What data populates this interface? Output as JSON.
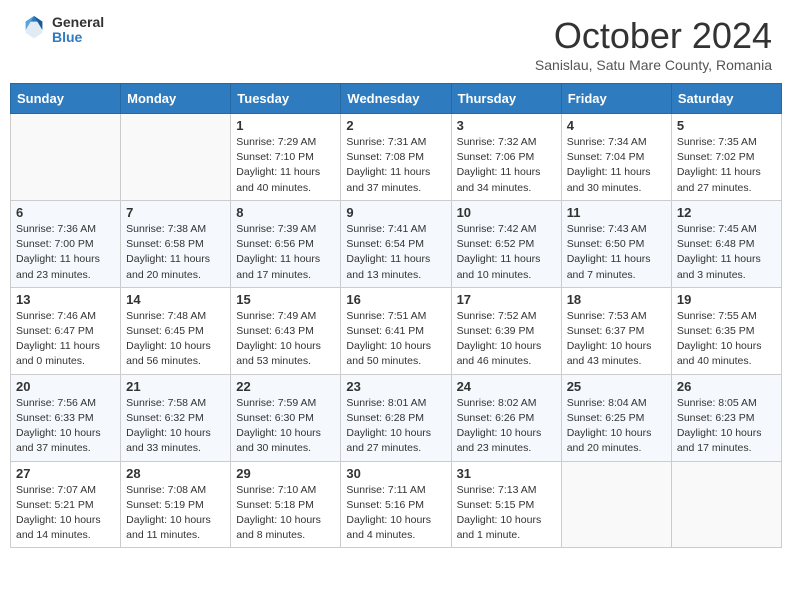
{
  "header": {
    "logo": {
      "general": "General",
      "blue": "Blue"
    },
    "title": "October 2024",
    "subtitle": "Sanislau, Satu Mare County, Romania"
  },
  "days_of_week": [
    "Sunday",
    "Monday",
    "Tuesday",
    "Wednesday",
    "Thursday",
    "Friday",
    "Saturday"
  ],
  "weeks": [
    [
      {
        "day": "",
        "info": ""
      },
      {
        "day": "",
        "info": ""
      },
      {
        "day": "1",
        "info": "Sunrise: 7:29 AM\nSunset: 7:10 PM\nDaylight: 11 hours and 40 minutes."
      },
      {
        "day": "2",
        "info": "Sunrise: 7:31 AM\nSunset: 7:08 PM\nDaylight: 11 hours and 37 minutes."
      },
      {
        "day": "3",
        "info": "Sunrise: 7:32 AM\nSunset: 7:06 PM\nDaylight: 11 hours and 34 minutes."
      },
      {
        "day": "4",
        "info": "Sunrise: 7:34 AM\nSunset: 7:04 PM\nDaylight: 11 hours and 30 minutes."
      },
      {
        "day": "5",
        "info": "Sunrise: 7:35 AM\nSunset: 7:02 PM\nDaylight: 11 hours and 27 minutes."
      }
    ],
    [
      {
        "day": "6",
        "info": "Sunrise: 7:36 AM\nSunset: 7:00 PM\nDaylight: 11 hours and 23 minutes."
      },
      {
        "day": "7",
        "info": "Sunrise: 7:38 AM\nSunset: 6:58 PM\nDaylight: 11 hours and 20 minutes."
      },
      {
        "day": "8",
        "info": "Sunrise: 7:39 AM\nSunset: 6:56 PM\nDaylight: 11 hours and 17 minutes."
      },
      {
        "day": "9",
        "info": "Sunrise: 7:41 AM\nSunset: 6:54 PM\nDaylight: 11 hours and 13 minutes."
      },
      {
        "day": "10",
        "info": "Sunrise: 7:42 AM\nSunset: 6:52 PM\nDaylight: 11 hours and 10 minutes."
      },
      {
        "day": "11",
        "info": "Sunrise: 7:43 AM\nSunset: 6:50 PM\nDaylight: 11 hours and 7 minutes."
      },
      {
        "day": "12",
        "info": "Sunrise: 7:45 AM\nSunset: 6:48 PM\nDaylight: 11 hours and 3 minutes."
      }
    ],
    [
      {
        "day": "13",
        "info": "Sunrise: 7:46 AM\nSunset: 6:47 PM\nDaylight: 11 hours and 0 minutes."
      },
      {
        "day": "14",
        "info": "Sunrise: 7:48 AM\nSunset: 6:45 PM\nDaylight: 10 hours and 56 minutes."
      },
      {
        "day": "15",
        "info": "Sunrise: 7:49 AM\nSunset: 6:43 PM\nDaylight: 10 hours and 53 minutes."
      },
      {
        "day": "16",
        "info": "Sunrise: 7:51 AM\nSunset: 6:41 PM\nDaylight: 10 hours and 50 minutes."
      },
      {
        "day": "17",
        "info": "Sunrise: 7:52 AM\nSunset: 6:39 PM\nDaylight: 10 hours and 46 minutes."
      },
      {
        "day": "18",
        "info": "Sunrise: 7:53 AM\nSunset: 6:37 PM\nDaylight: 10 hours and 43 minutes."
      },
      {
        "day": "19",
        "info": "Sunrise: 7:55 AM\nSunset: 6:35 PM\nDaylight: 10 hours and 40 minutes."
      }
    ],
    [
      {
        "day": "20",
        "info": "Sunrise: 7:56 AM\nSunset: 6:33 PM\nDaylight: 10 hours and 37 minutes."
      },
      {
        "day": "21",
        "info": "Sunrise: 7:58 AM\nSunset: 6:32 PM\nDaylight: 10 hours and 33 minutes."
      },
      {
        "day": "22",
        "info": "Sunrise: 7:59 AM\nSunset: 6:30 PM\nDaylight: 10 hours and 30 minutes."
      },
      {
        "day": "23",
        "info": "Sunrise: 8:01 AM\nSunset: 6:28 PM\nDaylight: 10 hours and 27 minutes."
      },
      {
        "day": "24",
        "info": "Sunrise: 8:02 AM\nSunset: 6:26 PM\nDaylight: 10 hours and 23 minutes."
      },
      {
        "day": "25",
        "info": "Sunrise: 8:04 AM\nSunset: 6:25 PM\nDaylight: 10 hours and 20 minutes."
      },
      {
        "day": "26",
        "info": "Sunrise: 8:05 AM\nSunset: 6:23 PM\nDaylight: 10 hours and 17 minutes."
      }
    ],
    [
      {
        "day": "27",
        "info": "Sunrise: 7:07 AM\nSunset: 5:21 PM\nDaylight: 10 hours and 14 minutes."
      },
      {
        "day": "28",
        "info": "Sunrise: 7:08 AM\nSunset: 5:19 PM\nDaylight: 10 hours and 11 minutes."
      },
      {
        "day": "29",
        "info": "Sunrise: 7:10 AM\nSunset: 5:18 PM\nDaylight: 10 hours and 8 minutes."
      },
      {
        "day": "30",
        "info": "Sunrise: 7:11 AM\nSunset: 5:16 PM\nDaylight: 10 hours and 4 minutes."
      },
      {
        "day": "31",
        "info": "Sunrise: 7:13 AM\nSunset: 5:15 PM\nDaylight: 10 hours and 1 minute."
      },
      {
        "day": "",
        "info": ""
      },
      {
        "day": "",
        "info": ""
      }
    ]
  ]
}
